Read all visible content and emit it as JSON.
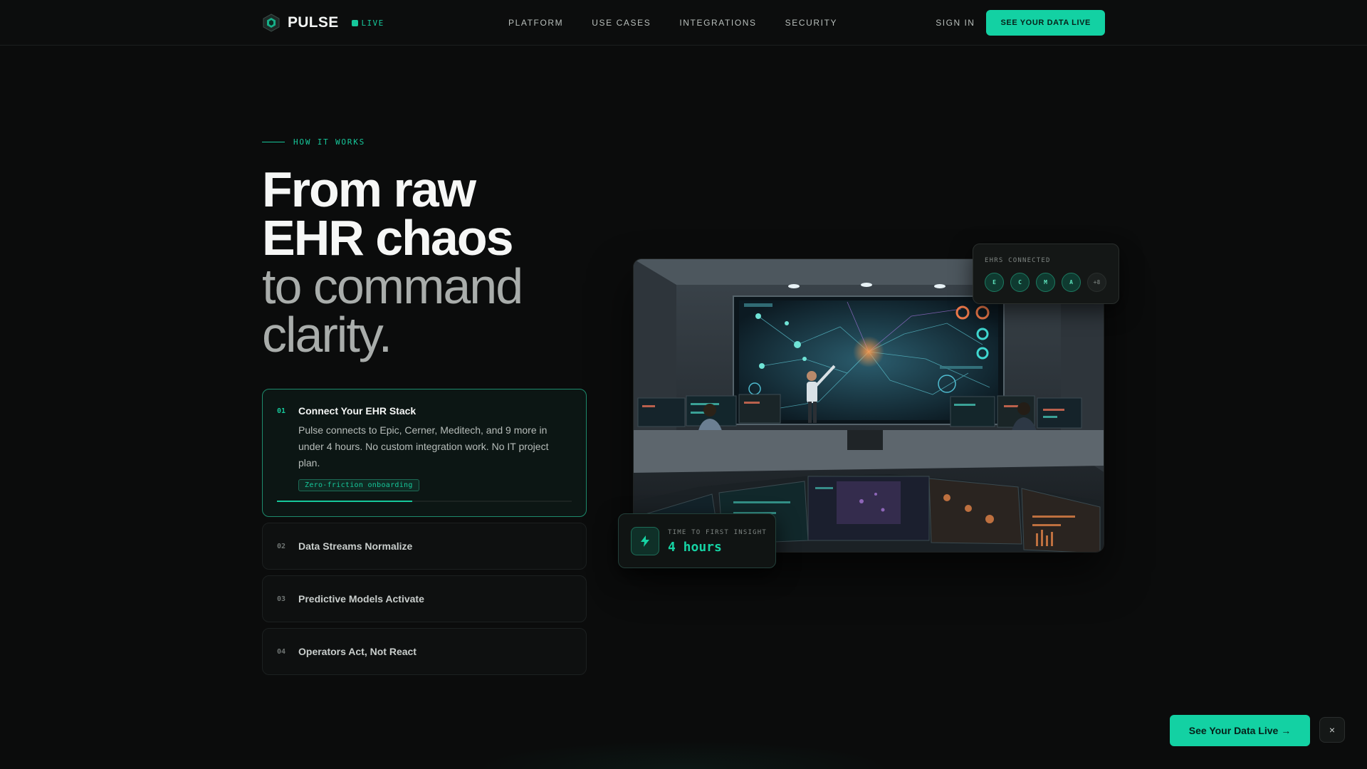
{
  "nav": {
    "brand": "PULSE",
    "live_label": "LIVE",
    "links": [
      "PLATFORM",
      "USE CASES",
      "INTEGRATIONS",
      "SECURITY"
    ],
    "sign_in": "SIGN IN",
    "cta": "SEE YOUR DATA LIVE"
  },
  "hero": {
    "eyebrow": "HOW IT WORKS",
    "headline_strong_1": "From raw",
    "headline_strong_2": "EHR chaos",
    "headline_light_1": "to command",
    "headline_light_2": "clarity."
  },
  "steps": [
    {
      "num": "01",
      "title": "Connect Your EHR Stack",
      "desc": "Pulse connects to Epic, Cerner, Meditech, and 9 more in under 4 hours. No custom integration work. No IT project plan.",
      "tag": "Zero-friction onboarding",
      "progress": 0.46
    },
    {
      "num": "02",
      "title": "Data Streams Normalize"
    },
    {
      "num": "03",
      "title": "Predictive Models Activate"
    },
    {
      "num": "04",
      "title": "Operators Act, Not React"
    }
  ],
  "ehr_card": {
    "label": "EHRS CONNECTED",
    "dots": [
      "E",
      "C",
      "M",
      "A"
    ],
    "more": "+8"
  },
  "insight_card": {
    "label": "TIME TO FIRST INSIGHT",
    "value": "4 hours"
  },
  "floating_cta": {
    "label": "See Your Data Live →",
    "close": "×"
  },
  "colors": {
    "accent": "#13d1a3",
    "background": "#0b0c0c"
  }
}
